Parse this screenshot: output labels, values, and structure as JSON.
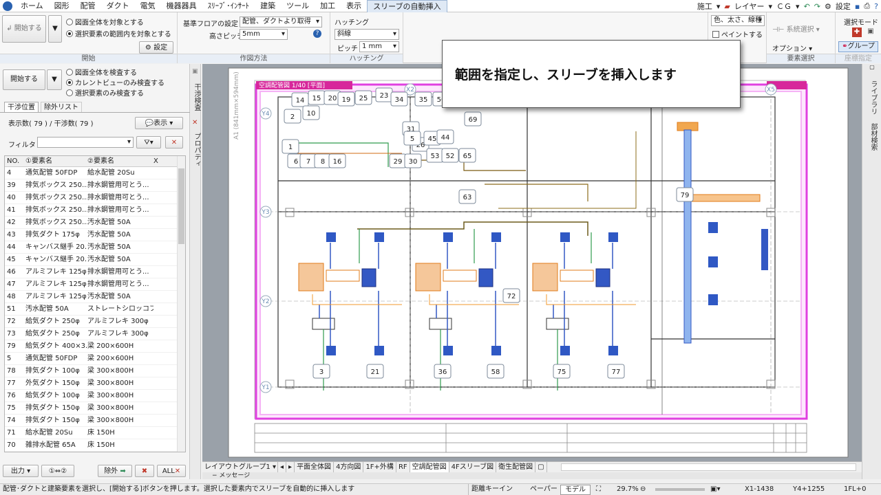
{
  "menubar": {
    "app_icon": "app-logo-icon",
    "items": [
      "ホーム",
      "図形",
      "配管",
      "ダクト",
      "電気",
      "機器器具",
      "ｽﾘｰﾌﾞ･ｲﾝｻｰﾄ",
      "建築",
      "ツール",
      "加工",
      "表示",
      "スリーブの自動挿入"
    ],
    "right": {
      "construct": "施工",
      "layer": "レイヤー",
      "cg": "ＣＧ",
      "settings": "設定"
    }
  },
  "ribbon": {
    "start_group": {
      "start_label": "開始する",
      "radio_all": "図面全体を対象とする",
      "radio_selected": "選択要素の範囲内を対象とする",
      "settings_button": "設定",
      "title": "開始"
    },
    "draw_group": {
      "floor_label": "基準フロアの設定",
      "floor_value": "配管、ダクトより取得",
      "pitch_label": "高さピッチ",
      "pitch_value": "5mm",
      "title": "作図方法"
    },
    "hatch_group": {
      "hatch_label": "ハッチング",
      "hatch_value": "斜線",
      "pitch_label": "ピッチ",
      "pitch_value": "1 mm",
      "title": "ハッチング"
    },
    "right_group": {
      "style_value": "色、太さ、線種",
      "paint_label": "ペイントする",
      "system_select": "系統選択",
      "option": "オプション",
      "element_title": "要素選択",
      "select_mode": "選択モード",
      "group": "グループ",
      "coord_title": "座標指定"
    }
  },
  "callout": {
    "text": "範囲を指定し、スリーブを挿入します"
  },
  "leftpanel": {
    "start_label": "開始する",
    "radio_all": "図面全体を検査する",
    "radio_current": "カレントビューのみ検査する",
    "radio_selected": "選択要素のみ検査する",
    "tab_position": "干渉位置",
    "tab_exclude": "除外リスト",
    "counts": "表示数( 79 ) / 干渉数( 79 )",
    "show_button": "表示",
    "filter_label": "フィルタ",
    "columns": [
      "NO.",
      "①要素名",
      "②要素名",
      "X"
    ],
    "rows": [
      [
        "4",
        "通気配管 50FDP",
        "給水配管 20Su"
      ],
      [
        "39",
        "排気ボックス 250...",
        "排水鋼管用可とう..."
      ],
      [
        "40",
        "排気ボックス 250...",
        "排水鋼管用可とう..."
      ],
      [
        "41",
        "排気ボックス 250...",
        "排水鋼管用可とう..."
      ],
      [
        "42",
        "排気ボックス 250...",
        "汚水配管 50A"
      ],
      [
        "43",
        "排気ダクト 175φ",
        "汚水配管 50A"
      ],
      [
        "44",
        "キャンバス継手 20...",
        "汚水配管 50A"
      ],
      [
        "45",
        "キャンバス継手 20...",
        "汚水配管 50A"
      ],
      [
        "46",
        "アルミフレキ 125φ",
        "排水鋼管用可とう..."
      ],
      [
        "47",
        "アルミフレキ 125φ",
        "排水鋼管用可とう..."
      ],
      [
        "48",
        "アルミフレキ 125φ",
        "汚水配管 50A"
      ],
      [
        "51",
        "汚水配管 50A",
        "ストレートシロッコフ..."
      ],
      [
        "72",
        "給気ダクト 250φ",
        "アルミフレキ 300φ"
      ],
      [
        "73",
        "給気ダクト 250φ",
        "アルミフレキ 300φ"
      ],
      [
        "79",
        "給気ダクト 400×3...",
        "梁 200×600H"
      ],
      [
        "5",
        "通気配管 50FDP",
        "梁 200×600H"
      ],
      [
        "78",
        "排気ダクト 100φ",
        "梁 300×800H"
      ],
      [
        "77",
        "外気ダクト 150φ",
        "梁 300×800H"
      ],
      [
        "76",
        "給気ダクト 100φ",
        "梁 300×800H"
      ],
      [
        "75",
        "排気ダクト 150φ",
        "梁 300×800H"
      ],
      [
        "74",
        "排気ダクト 150φ",
        "梁 300×800H"
      ],
      [
        "71",
        "給水配管 20Su",
        "床 150H"
      ],
      [
        "70",
        "雑排水配管 65A",
        "床 150H"
      ]
    ],
    "output_button": "出力",
    "swap_button": "①⇔②",
    "exclude_button": "除外",
    "all_button": "ALL",
    "vtab_interference": "干渉検査",
    "vtab_property": "プロパティ"
  },
  "canvas": {
    "paper_label": "A1 (841mm×594mm)",
    "view_title": "空調配管図 1/40 [平面]",
    "grid_labels": [
      "Y4",
      "Y3",
      "Y2",
      "Y1",
      "X2",
      "X5"
    ],
    "markers": [
      "14",
      "15",
      "20",
      "19",
      "25",
      "23",
      "34",
      "35",
      "56",
      "2",
      "10",
      "26",
      "31",
      "5",
      "45",
      "44",
      "69",
      "1",
      "6",
      "7",
      "8",
      "16",
      "29",
      "30",
      "53",
      "52",
      "65",
      "63",
      "79",
      "72",
      "3",
      "21",
      "36",
      "58",
      "75",
      "77"
    ]
  },
  "rightside": {
    "tab1": "ライブラリ",
    "tab2": "部材検索"
  },
  "tabbar": {
    "layout_group": "レイアウトグループ1",
    "tabs": [
      "平面全体図",
      "4方向図",
      "1F+外構",
      "RF",
      "空調配管図",
      "4Fスリーブ図",
      "衛生配管図"
    ]
  },
  "msgbar": {
    "label": "メッセージ"
  },
  "statusbar": {
    "message": "配管･ダクトと建築要素を選択し、[開始する]ボタンを押します。選択した要素内でスリーブを自動的に挿入します",
    "distance": "距離キーイン",
    "paper": "ペーパー",
    "model": "モデル",
    "zoom": "29.7%",
    "x": "X1-1438",
    "y": "Y4+1255",
    "floor": "1FL+0"
  }
}
